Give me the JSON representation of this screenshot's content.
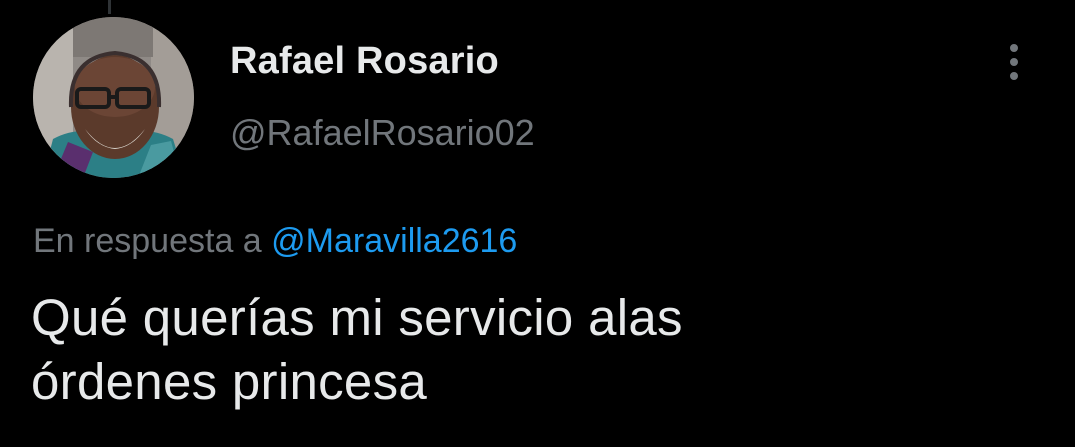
{
  "tweet": {
    "author": {
      "display_name": "Rafael Rosario",
      "handle": "@RafaelRosario02",
      "avatar_icon": "user-avatar-photo"
    },
    "reply_context": {
      "prefix": "En respuesta a",
      "mention": "@Maravilla2616"
    },
    "text_lines": [
      "Qué querías mi servicio alas",
      "órdenes princesa"
    ],
    "more_icon": "vertical-ellipsis-icon"
  },
  "colors": {
    "background": "#000000",
    "primary_text": "#e7e9ea",
    "secondary_text": "#71767b",
    "link": "#1d9bf0"
  }
}
